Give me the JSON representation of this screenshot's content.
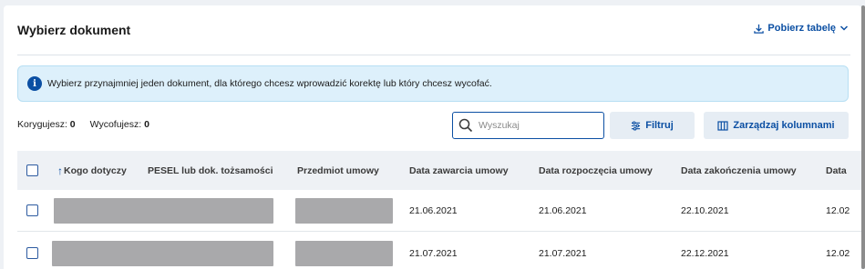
{
  "header": {
    "title": "Wybierz dokument",
    "download_label": "Pobierz tabelę"
  },
  "info": {
    "message": "Wybierz przynajmniej jeden dokument, dla którego chcesz wprowadzić korektę lub który chcesz wycofać."
  },
  "counters": {
    "correcting_label": "Korygujesz:",
    "correcting_value": "0",
    "withdrawing_label": "Wycofujesz:",
    "withdrawing_value": "0"
  },
  "search": {
    "placeholder": "Wyszukaj"
  },
  "toolbar": {
    "filter_label": "Filtruj",
    "columns_label": "Zarządzaj kolumnami"
  },
  "table": {
    "columns": [
      "Kogo dotyczy",
      "PESEL lub dok. tożsamości",
      "Przedmiot umowy",
      "Data zawarcia umowy",
      "Data rozpoczęcia umowy",
      "Data zakończenia umowy",
      "Data"
    ],
    "rows": [
      {
        "conclusion_date": "21.06.2021",
        "start_date": "21.06.2021",
        "end_date": "22.10.2021",
        "next": "12.02"
      },
      {
        "conclusion_date": "21.07.2021",
        "start_date": "21.07.2021",
        "end_date": "22.12.2021",
        "next": "12.02"
      }
    ]
  },
  "colors": {
    "accent": "#0b4fa3",
    "info_bg": "#ddf0fb",
    "redacted": "#a9a9ab"
  }
}
